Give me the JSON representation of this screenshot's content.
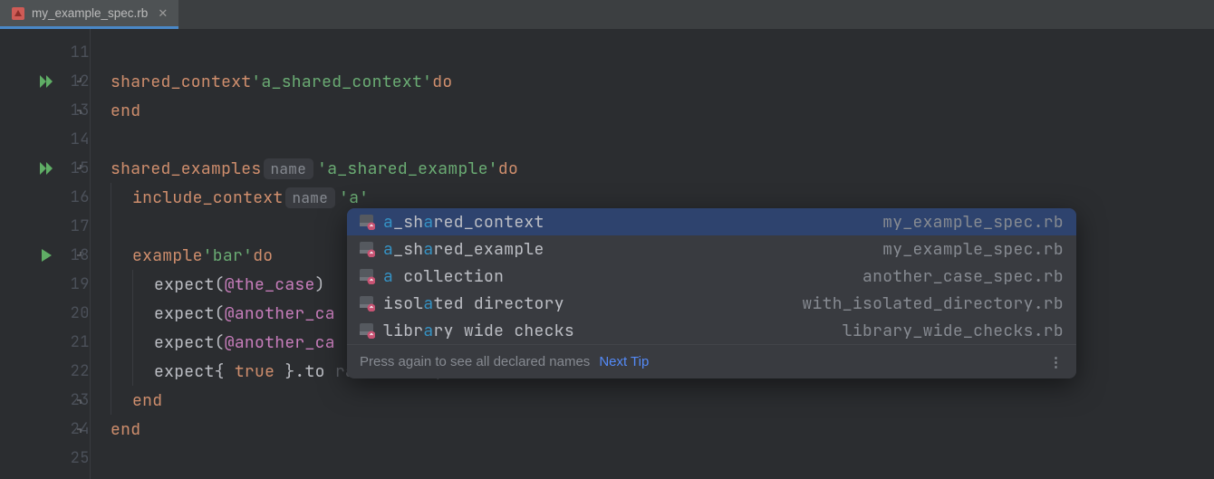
{
  "tab": {
    "filename": "my_example_spec.rb"
  },
  "lines": [
    {
      "n": 11,
      "run": "",
      "fold": ""
    },
    {
      "n": 12,
      "run": "dbl",
      "fold": "down"
    },
    {
      "n": 13,
      "run": "",
      "fold": "up"
    },
    {
      "n": 14,
      "run": "",
      "fold": ""
    },
    {
      "n": 15,
      "run": "dbl",
      "fold": "down"
    },
    {
      "n": 16,
      "run": "",
      "fold": ""
    },
    {
      "n": 17,
      "run": "",
      "fold": ""
    },
    {
      "n": 18,
      "run": "single",
      "fold": "down"
    },
    {
      "n": 19,
      "run": "",
      "fold": ""
    },
    {
      "n": 20,
      "run": "",
      "fold": ""
    },
    {
      "n": 21,
      "run": "",
      "fold": ""
    },
    {
      "n": 22,
      "run": "",
      "fold": ""
    },
    {
      "n": 23,
      "run": "",
      "fold": "up"
    },
    {
      "n": 24,
      "run": "",
      "fold": "up"
    },
    {
      "n": 25,
      "run": "",
      "fold": ""
    }
  ],
  "code": {
    "l12": {
      "kw": "shared_context",
      "str": "'a_shared_context'",
      "do": "do"
    },
    "l13": {
      "kw": "end"
    },
    "l15": {
      "kw": "shared_examples",
      "hint": "name",
      "str": "'a_shared_example'",
      "do": "do"
    },
    "l16": {
      "kw": "include_context",
      "hint": "name",
      "str": "'a'"
    },
    "l18": {
      "kw": "example",
      "str": "'bar'",
      "do": "do"
    },
    "l19": {
      "m": "expect",
      "ivar": "@the_case",
      "tail": ")"
    },
    "l20": {
      "m": "expect",
      "ivar": "@another_ca",
      "tail": ""
    },
    "l21": {
      "m": "expect",
      "ivar": "@another_ca",
      "tail": ""
    },
    "l22": {
      "m": "expect",
      "true": "true",
      "tail": " }.to "
    },
    "l23": {
      "kw": "end"
    },
    "l24": {
      "kw": "end"
    }
  },
  "popup": {
    "items": [
      {
        "pre": "a",
        "match": "_sh",
        "mid": "",
        "match2": "a",
        "post": "red_context",
        "loc": "my_example_spec.rb",
        "selected": true
      },
      {
        "pre": "a",
        "match": "_sh",
        "mid": "",
        "match2": "a",
        "post": "red_example",
        "loc": "my_example_spec.rb"
      },
      {
        "pre": "a",
        "match": " ",
        "mid": "collection",
        "match2": "",
        "post": "",
        "loc": "another_case_spec.rb",
        "simple": true,
        "first": "a",
        "rest": " collection"
      },
      {
        "pre": "isol",
        "match": "a",
        "mid": "ted directory",
        "match2": "",
        "post": "",
        "loc": "with_isolated_directory.rb"
      },
      {
        "pre": "libr",
        "match": "a",
        "mid": "ry wide checks",
        "match2": "",
        "post": "",
        "loc": "library_wide_checks.rb"
      }
    ],
    "footer": {
      "hint": "Press again to see all declared names",
      "link": "Next Tip"
    }
  }
}
